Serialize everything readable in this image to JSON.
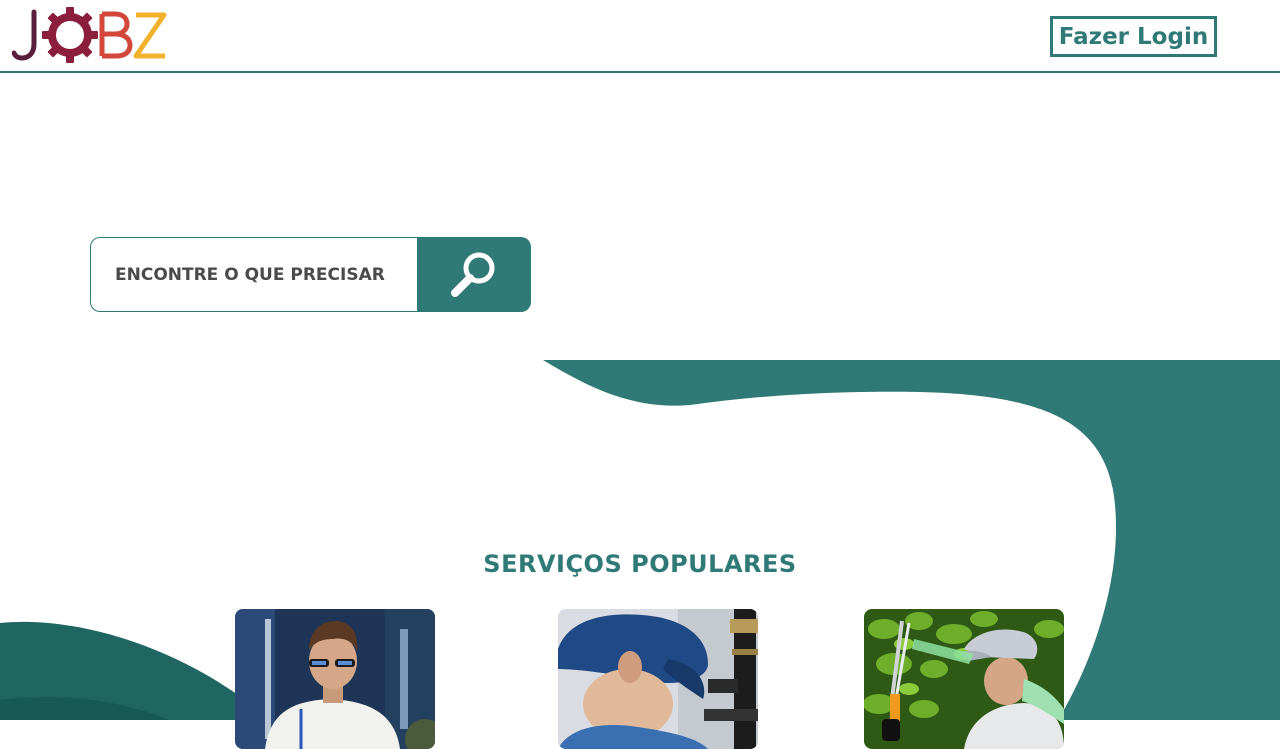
{
  "header": {
    "logo_text": "JOBZ",
    "login_label": "Fazer Login"
  },
  "search": {
    "placeholder": "ENCONTRE O QUE PRECISAR",
    "button_icon": "search-icon"
  },
  "popular": {
    "title": "SERVIÇOS POPULARES",
    "cards": [
      {
        "icon": "technician-photo"
      },
      {
        "icon": "plumber-photo"
      },
      {
        "icon": "gardener-photo"
      }
    ]
  },
  "colors": {
    "primary": "#2f7a76",
    "logo_gradient": [
      "#5a1d3c",
      "#b0203a",
      "#f2b12a"
    ],
    "text_dark": "#4a4a4a"
  }
}
